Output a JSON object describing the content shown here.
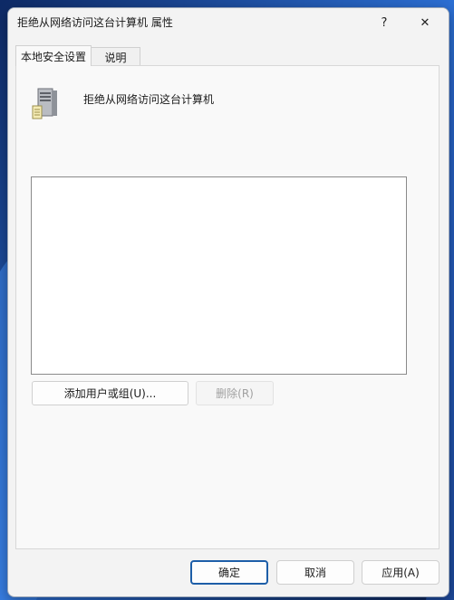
{
  "window": {
    "title": "拒绝从网络访问这台计算机 属性",
    "help_glyph": "?",
    "close_glyph": "✕"
  },
  "tabs": [
    {
      "label": "本地安全设置",
      "active": true
    },
    {
      "label": "说明",
      "active": false
    }
  ],
  "policy": {
    "icon": "server-icon",
    "name": "拒绝从网络访问这台计算机"
  },
  "members_list": {
    "items": []
  },
  "buttons": {
    "add_label": "添加用户或组(U)...",
    "remove_label": "删除(R)",
    "ok_label": "确定",
    "cancel_label": "取消",
    "apply_label": "应用(A)"
  },
  "colors": {
    "accent": "#1d5ea8",
    "desktop": "#1a3f86"
  }
}
